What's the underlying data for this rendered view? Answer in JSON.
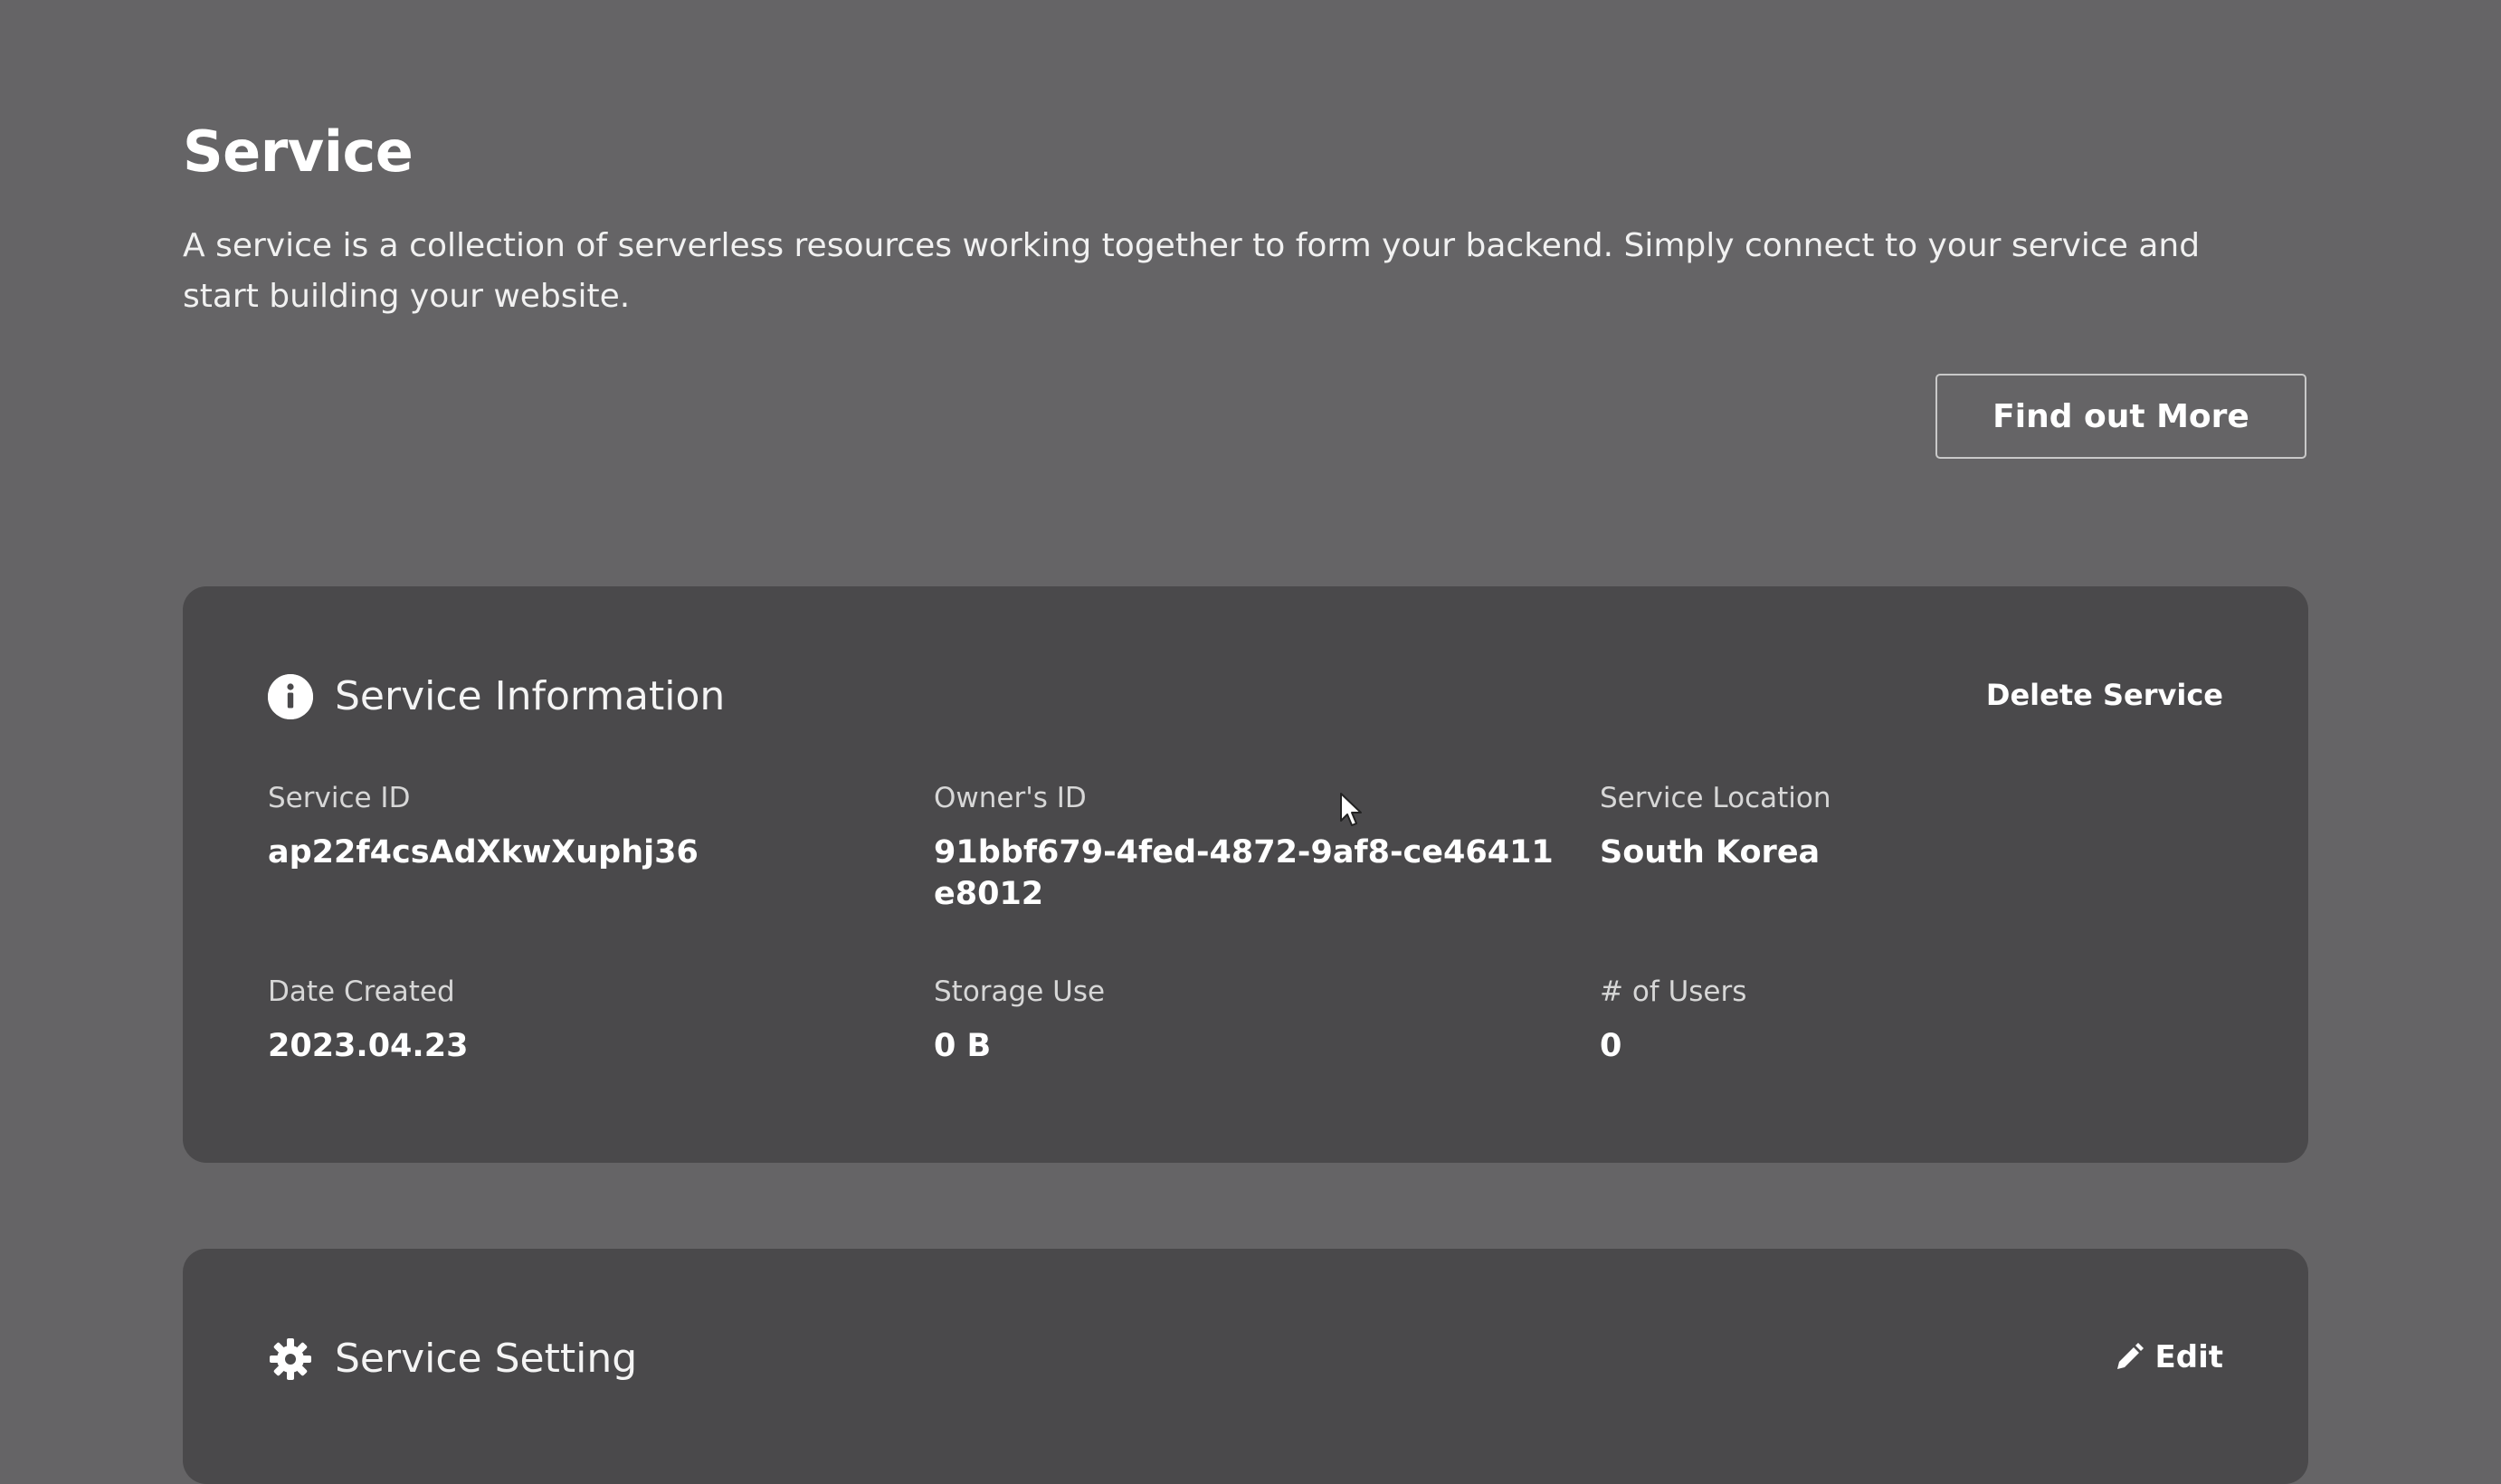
{
  "header": {
    "title": "Service",
    "description": "A service is a collection of serverless resources working together to form your backend. Simply connect to your service and start building your website.",
    "find_out_more_label": "Find out More"
  },
  "service_information": {
    "icon": "info-icon",
    "title": "Service Information",
    "delete_label": "Delete Service",
    "fields": [
      {
        "label": "Service ID",
        "value": "ap22f4csAdXkwXuphj36"
      },
      {
        "label": "Owner's ID",
        "value": "91bbf679-4fed-4872-9af8-ce46411e8012"
      },
      {
        "label": "Service Location",
        "value": "South Korea"
      },
      {
        "label": "Date Created",
        "value": "2023.04.23"
      },
      {
        "label": "Storage Use",
        "value": "0 B"
      },
      {
        "label": "# of Users",
        "value": "0"
      }
    ]
  },
  "service_setting": {
    "icon": "gear-icon",
    "title": "Service Setting",
    "edit_label": "Edit",
    "edit_icon": "pencil-icon"
  },
  "colors": {
    "background": "#656466",
    "card": "#4a494b",
    "text": "#ffffff",
    "label": "#d7d7d7",
    "button_border": "#c9c9c9"
  }
}
